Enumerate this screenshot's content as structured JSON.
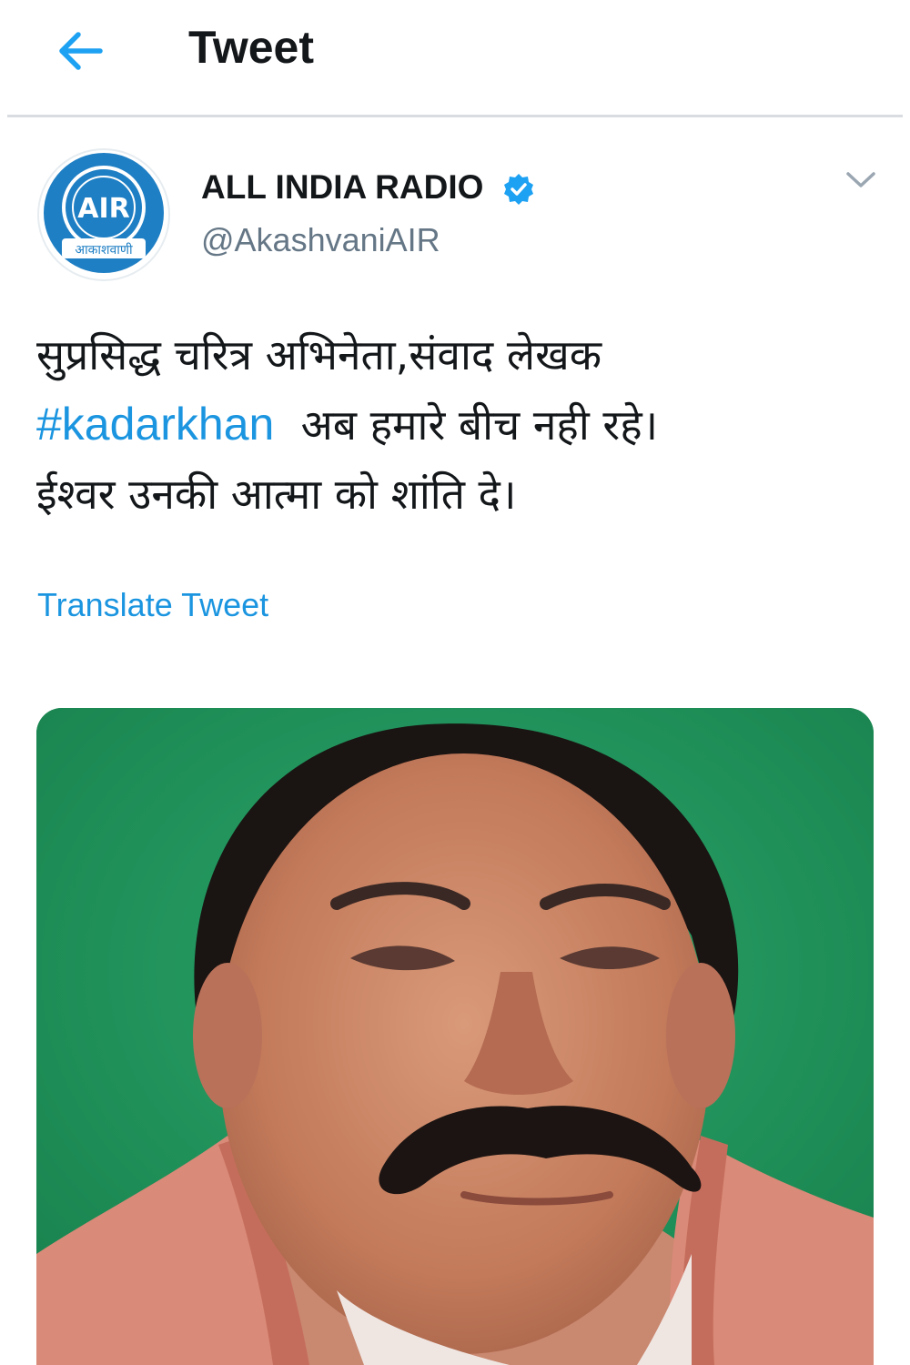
{
  "header": {
    "title": "Tweet",
    "back_icon": "arrow-left-icon",
    "accent_color": "#1da1f2"
  },
  "author": {
    "name": "ALL INDIA RADIO",
    "handle": "@AkashvaniAIR",
    "verified": true,
    "avatar": {
      "icon": "all-india-radio-logo",
      "logo_text": "AIR",
      "logo_banner": "आकाशवाणी"
    }
  },
  "tweet": {
    "lines": [
      "सुप्रसिद्ध चरित्र अभिनेता,संवाद लेखक",
      "अब हमारे बीच नही रहे।",
      "ईश्वर उनकी आत्मा को शांति दे।"
    ],
    "hashtag": "#kadarkhan",
    "translate_label": "Translate Tweet",
    "link_color": "#1b95e0"
  },
  "media": {
    "kind": "photo"
  }
}
